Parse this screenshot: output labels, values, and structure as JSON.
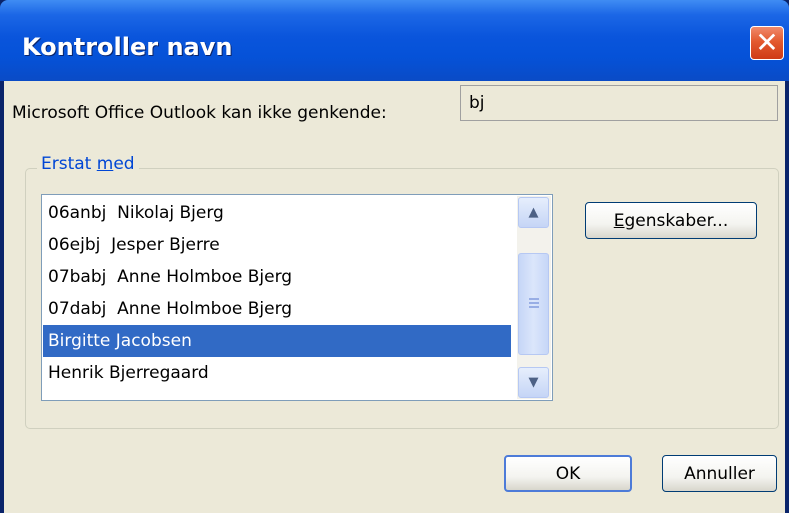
{
  "window": {
    "title": "Kontroller navn",
    "close_glyph": "✕"
  },
  "prompt": {
    "label": "Microsoft Office Outlook kan ikke genkende:",
    "value": "bj"
  },
  "group": {
    "legend_prefix": "Erstat ",
    "legend_underlined": "m",
    "legend_suffix": "ed"
  },
  "list": {
    "items": [
      "06anbj  Nikolaj Bjerg",
      "06ejbj  Jesper Bjerre",
      "07babj  Anne Holmboe Bjerg",
      "07dabj  Anne Holmboe Bjerg",
      "Birgitte Jacobsen",
      "Henrik Bjerregaard"
    ],
    "selected_index": 4,
    "scroll_up_glyph": "▲",
    "scroll_down_glyph": "▼"
  },
  "buttons": {
    "properties_underlined": "E",
    "properties_rest": "genskaber...",
    "ok": "OK",
    "cancel": "Annuller"
  },
  "colors": {
    "titlebar": "#0552d8",
    "selection": "#316ac5",
    "dialog_face": "#ece9d8",
    "legend_text": "#0046d5"
  }
}
